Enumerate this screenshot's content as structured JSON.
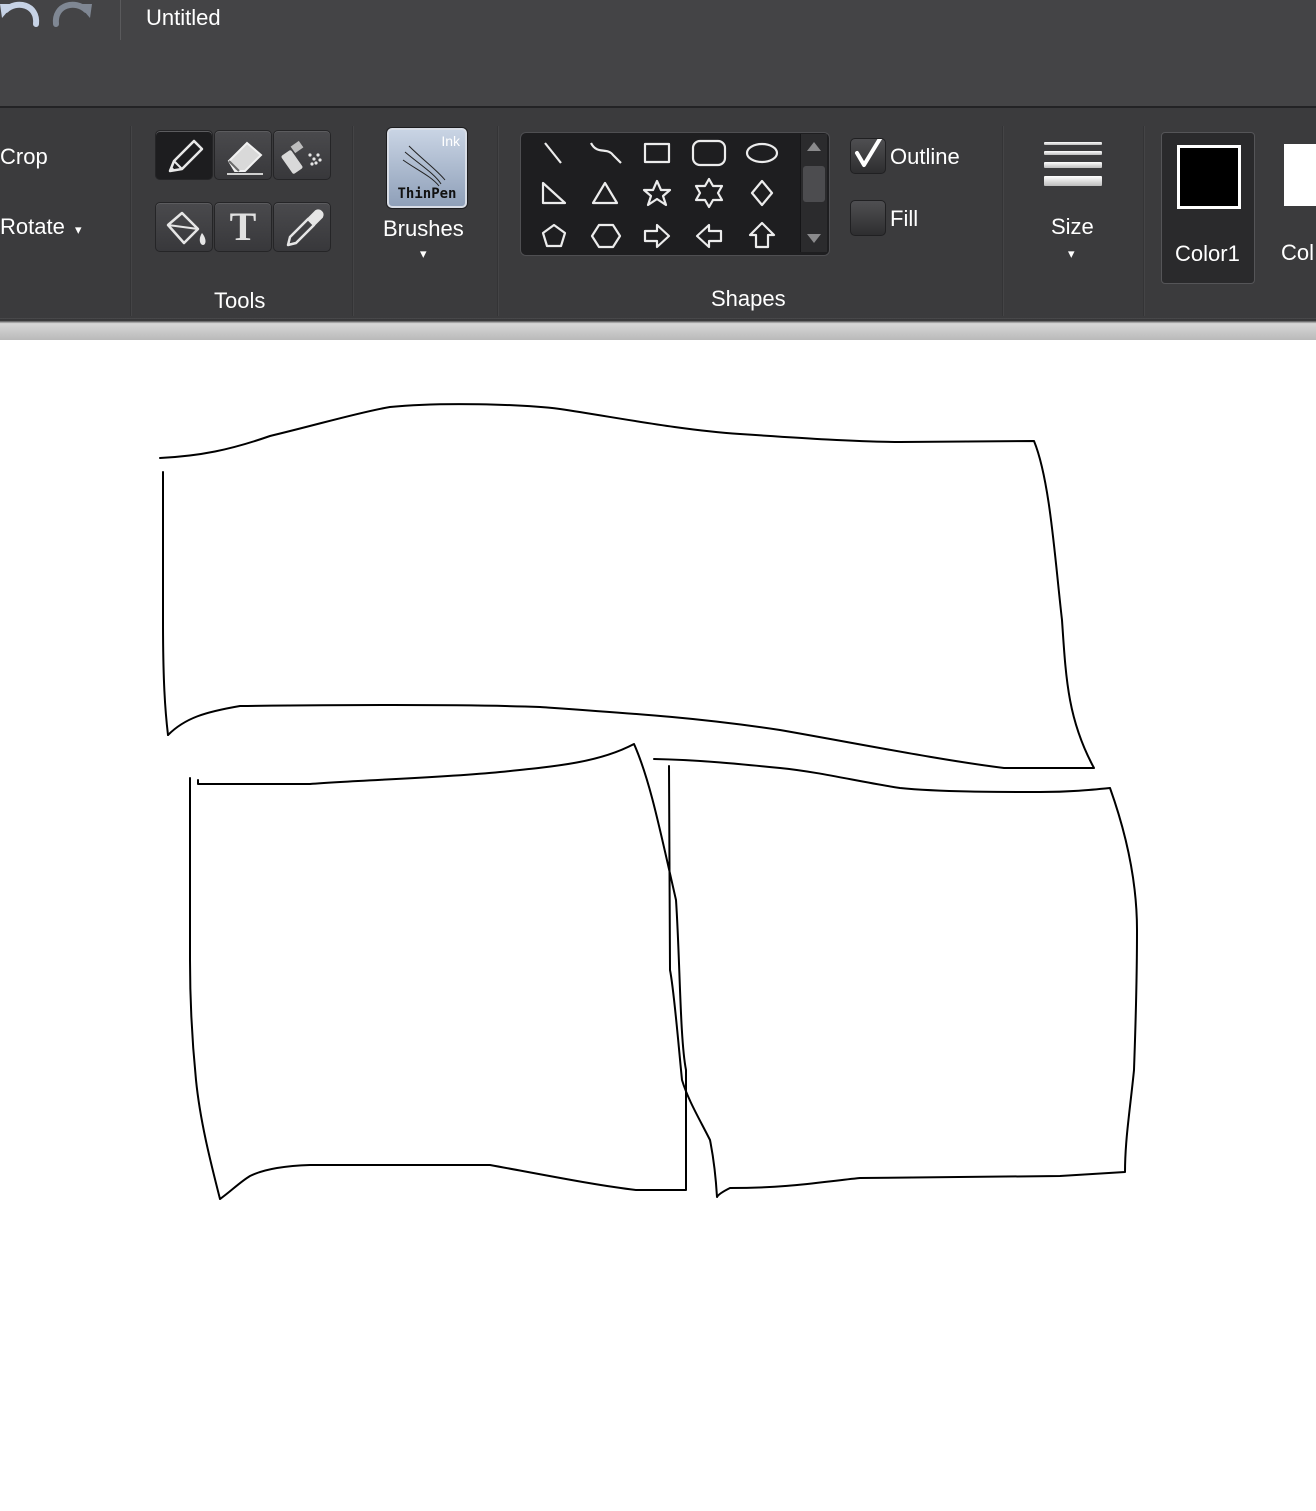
{
  "title_bar": {
    "document_title": "Untitled",
    "undo_icon": "undo-arrow-icon",
    "redo_icon": "redo-arrow-icon"
  },
  "ribbon": {
    "image_group": {
      "crop_label": "Crop",
      "rotate_label": "Rotate",
      "rotate_caret": "▾"
    },
    "tools_group": {
      "label": "Tools",
      "tools": [
        {
          "name": "pencil",
          "icon": "pencil-icon",
          "selected": true
        },
        {
          "name": "eraser",
          "icon": "eraser-icon",
          "selected": false
        },
        {
          "name": "airbrush",
          "icon": "airbrush-icon",
          "selected": false
        },
        {
          "name": "fill",
          "icon": "paint-bucket-icon",
          "selected": false
        },
        {
          "name": "text",
          "icon": "text-icon",
          "glyph": "T",
          "selected": false
        },
        {
          "name": "color-picker",
          "icon": "eyedropper-icon",
          "selected": false
        }
      ]
    },
    "brushes_group": {
      "thumb_top_text": "Ink",
      "thumb_bottom_text": "ThinPen",
      "label": "Brushes",
      "caret": "▾"
    },
    "shapes_group": {
      "label": "Shapes",
      "shapes": [
        "line",
        "curve",
        "rectangle",
        "rounded-rectangle",
        "ellipse",
        "right-triangle",
        "triangle",
        "star-5",
        "star-6",
        "diamond",
        "pentagon",
        "hexagon",
        "arrow-right",
        "arrow-left",
        "arrow-up"
      ],
      "outline_label": "Outline",
      "outline_checked": true,
      "fill_label": "Fill",
      "fill_checked": false
    },
    "size_group": {
      "label": "Size",
      "caret": "▾"
    },
    "colors_group": {
      "color1_label": "Color1",
      "color1_value": "#000000",
      "color2_label_visible": "Col",
      "color2_value": "#ffffff"
    }
  },
  "canvas": {
    "background": "#ffffff",
    "stroke_color": "#000000"
  }
}
